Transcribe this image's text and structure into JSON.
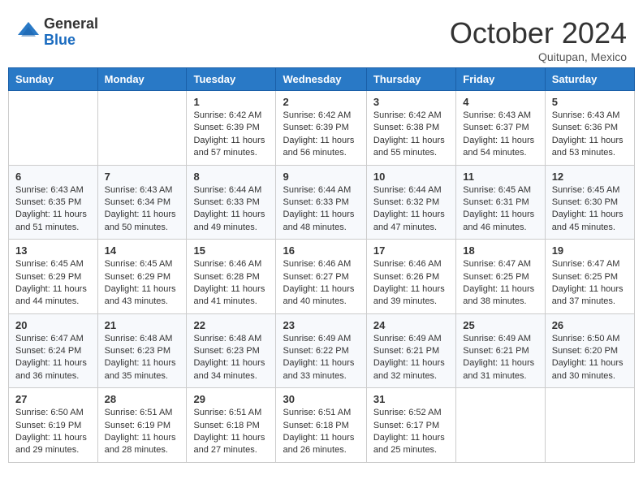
{
  "logo": {
    "general": "General",
    "blue": "Blue"
  },
  "header": {
    "month": "October 2024",
    "location": "Quitupan, Mexico"
  },
  "weekdays": [
    "Sunday",
    "Monday",
    "Tuesday",
    "Wednesday",
    "Thursday",
    "Friday",
    "Saturday"
  ],
  "weeks": [
    [
      {
        "day": "",
        "info": ""
      },
      {
        "day": "",
        "info": ""
      },
      {
        "day": "1",
        "info": "Sunrise: 6:42 AM\nSunset: 6:39 PM\nDaylight: 11 hours and 57 minutes."
      },
      {
        "day": "2",
        "info": "Sunrise: 6:42 AM\nSunset: 6:39 PM\nDaylight: 11 hours and 56 minutes."
      },
      {
        "day": "3",
        "info": "Sunrise: 6:42 AM\nSunset: 6:38 PM\nDaylight: 11 hours and 55 minutes."
      },
      {
        "day": "4",
        "info": "Sunrise: 6:43 AM\nSunset: 6:37 PM\nDaylight: 11 hours and 54 minutes."
      },
      {
        "day": "5",
        "info": "Sunrise: 6:43 AM\nSunset: 6:36 PM\nDaylight: 11 hours and 53 minutes."
      }
    ],
    [
      {
        "day": "6",
        "info": "Sunrise: 6:43 AM\nSunset: 6:35 PM\nDaylight: 11 hours and 51 minutes."
      },
      {
        "day": "7",
        "info": "Sunrise: 6:43 AM\nSunset: 6:34 PM\nDaylight: 11 hours and 50 minutes."
      },
      {
        "day": "8",
        "info": "Sunrise: 6:44 AM\nSunset: 6:33 PM\nDaylight: 11 hours and 49 minutes."
      },
      {
        "day": "9",
        "info": "Sunrise: 6:44 AM\nSunset: 6:33 PM\nDaylight: 11 hours and 48 minutes."
      },
      {
        "day": "10",
        "info": "Sunrise: 6:44 AM\nSunset: 6:32 PM\nDaylight: 11 hours and 47 minutes."
      },
      {
        "day": "11",
        "info": "Sunrise: 6:45 AM\nSunset: 6:31 PM\nDaylight: 11 hours and 46 minutes."
      },
      {
        "day": "12",
        "info": "Sunrise: 6:45 AM\nSunset: 6:30 PM\nDaylight: 11 hours and 45 minutes."
      }
    ],
    [
      {
        "day": "13",
        "info": "Sunrise: 6:45 AM\nSunset: 6:29 PM\nDaylight: 11 hours and 44 minutes."
      },
      {
        "day": "14",
        "info": "Sunrise: 6:45 AM\nSunset: 6:29 PM\nDaylight: 11 hours and 43 minutes."
      },
      {
        "day": "15",
        "info": "Sunrise: 6:46 AM\nSunset: 6:28 PM\nDaylight: 11 hours and 41 minutes."
      },
      {
        "day": "16",
        "info": "Sunrise: 6:46 AM\nSunset: 6:27 PM\nDaylight: 11 hours and 40 minutes."
      },
      {
        "day": "17",
        "info": "Sunrise: 6:46 AM\nSunset: 6:26 PM\nDaylight: 11 hours and 39 minutes."
      },
      {
        "day": "18",
        "info": "Sunrise: 6:47 AM\nSunset: 6:25 PM\nDaylight: 11 hours and 38 minutes."
      },
      {
        "day": "19",
        "info": "Sunrise: 6:47 AM\nSunset: 6:25 PM\nDaylight: 11 hours and 37 minutes."
      }
    ],
    [
      {
        "day": "20",
        "info": "Sunrise: 6:47 AM\nSunset: 6:24 PM\nDaylight: 11 hours and 36 minutes."
      },
      {
        "day": "21",
        "info": "Sunrise: 6:48 AM\nSunset: 6:23 PM\nDaylight: 11 hours and 35 minutes."
      },
      {
        "day": "22",
        "info": "Sunrise: 6:48 AM\nSunset: 6:23 PM\nDaylight: 11 hours and 34 minutes."
      },
      {
        "day": "23",
        "info": "Sunrise: 6:49 AM\nSunset: 6:22 PM\nDaylight: 11 hours and 33 minutes."
      },
      {
        "day": "24",
        "info": "Sunrise: 6:49 AM\nSunset: 6:21 PM\nDaylight: 11 hours and 32 minutes."
      },
      {
        "day": "25",
        "info": "Sunrise: 6:49 AM\nSunset: 6:21 PM\nDaylight: 11 hours and 31 minutes."
      },
      {
        "day": "26",
        "info": "Sunrise: 6:50 AM\nSunset: 6:20 PM\nDaylight: 11 hours and 30 minutes."
      }
    ],
    [
      {
        "day": "27",
        "info": "Sunrise: 6:50 AM\nSunset: 6:19 PM\nDaylight: 11 hours and 29 minutes."
      },
      {
        "day": "28",
        "info": "Sunrise: 6:51 AM\nSunset: 6:19 PM\nDaylight: 11 hours and 28 minutes."
      },
      {
        "day": "29",
        "info": "Sunrise: 6:51 AM\nSunset: 6:18 PM\nDaylight: 11 hours and 27 minutes."
      },
      {
        "day": "30",
        "info": "Sunrise: 6:51 AM\nSunset: 6:18 PM\nDaylight: 11 hours and 26 minutes."
      },
      {
        "day": "31",
        "info": "Sunrise: 6:52 AM\nSunset: 6:17 PM\nDaylight: 11 hours and 25 minutes."
      },
      {
        "day": "",
        "info": ""
      },
      {
        "day": "",
        "info": ""
      }
    ]
  ]
}
